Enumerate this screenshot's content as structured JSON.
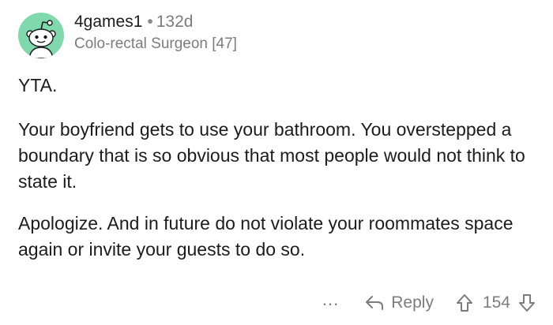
{
  "comment": {
    "author": "4games1",
    "separator": "•",
    "age": "132d",
    "flair": "Colo-rectal Surgeon [47]",
    "paragraphs": [
      "YTA.",
      "Your boyfriend gets to use your bathroom. You overstepped a boundary that is so obvious that most people would not think to state it.",
      "Apologize. And in future do not violate your roommates space again or invite your guests to do so."
    ],
    "actions": {
      "more_label": "...",
      "reply_label": "Reply",
      "vote_count": "154"
    },
    "colors": {
      "avatar_background": "#7fd9ad",
      "meta_text": "#7c7c7c",
      "body_text": "#1c1c1c"
    },
    "icons": {
      "avatar": "reddit-snoo-avatar",
      "reply": "reply-arrow-icon",
      "upvote": "upvote-arrow-icon",
      "downvote": "downvote-arrow-icon"
    }
  }
}
